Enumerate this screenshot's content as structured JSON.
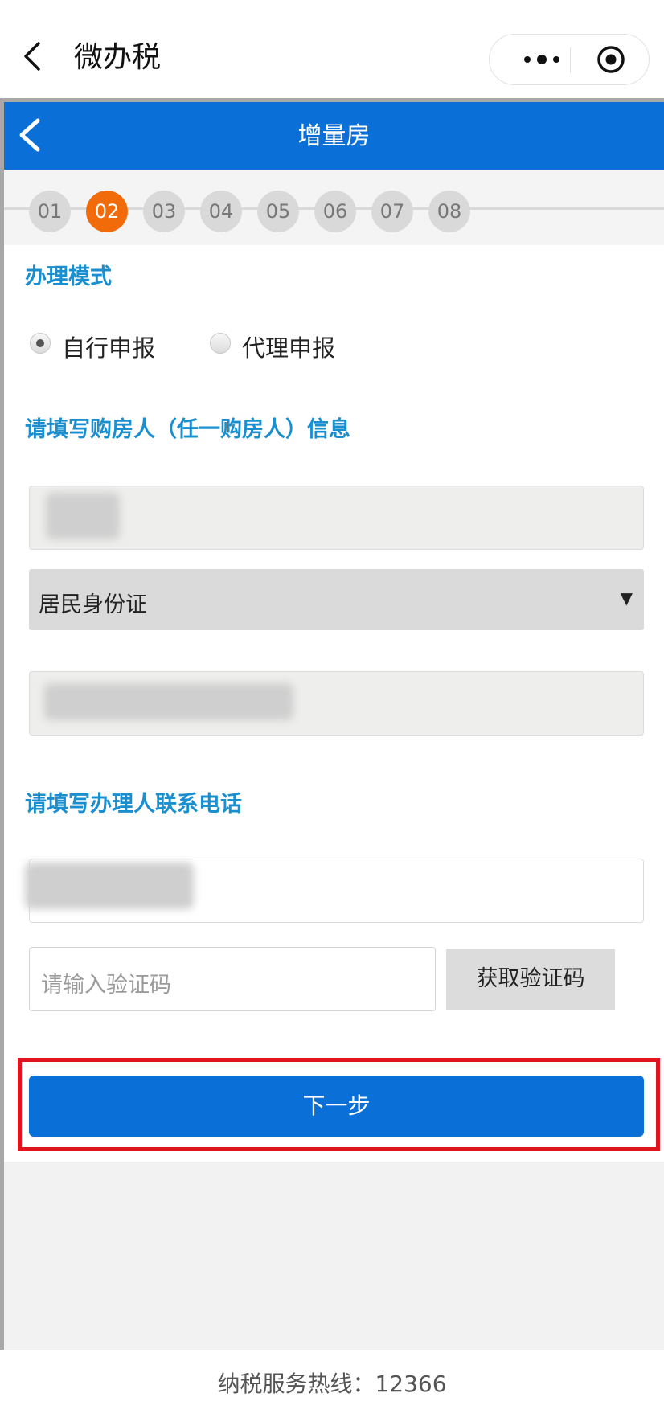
{
  "app": {
    "title": "微办税"
  },
  "page": {
    "title": "增量房"
  },
  "steps": {
    "items": [
      "01",
      "02",
      "03",
      "04",
      "05",
      "06",
      "07",
      "08"
    ],
    "active_index": 1
  },
  "mode": {
    "title": "办理模式",
    "options": [
      {
        "label": "自行申报",
        "selected": true
      },
      {
        "label": "代理申报",
        "selected": false
      }
    ]
  },
  "buyer": {
    "title": "请填写购房人（任一购房人）信息",
    "id_type": "居民身份证"
  },
  "contact": {
    "title": "请填写办理人联系电话",
    "code_placeholder": "请输入验证码",
    "get_code_label": "获取验证码"
  },
  "actions": {
    "next_label": "下一步"
  },
  "footer": {
    "hotline": "纳税服务热线：12366"
  },
  "colors": {
    "primary": "#0a6fd6",
    "active_step": "#f26b0b",
    "section_title": "#1a8fd0",
    "highlight": "#e0141e"
  },
  "icons": {
    "back": "chevron-left-icon",
    "more": "more-dots-icon",
    "close": "target-circle-icon",
    "select": "caret-down-icon"
  }
}
